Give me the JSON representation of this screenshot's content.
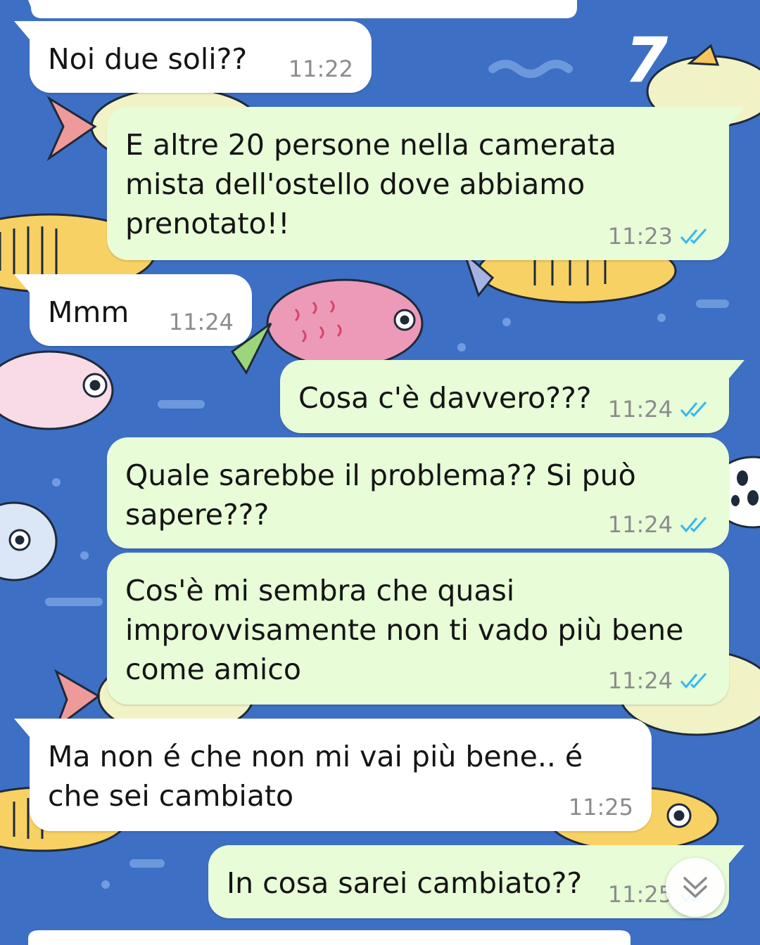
{
  "conversation": {
    "messages": [
      {
        "id": "m1",
        "direction": "incoming",
        "text": "Noi due soli??",
        "time": "11:22"
      },
      {
        "id": "m2",
        "direction": "outgoing",
        "text": "E altre 20 persone nella camerata\nmista dell'ostello dove abbiamo\nprenotato!!",
        "time": "11:23",
        "status": "read"
      },
      {
        "id": "m3",
        "direction": "incoming",
        "text": "Mmm",
        "time": "11:24"
      },
      {
        "id": "m4",
        "direction": "outgoing",
        "text": "Cosa c'è davvero???",
        "time": "11:24",
        "status": "read"
      },
      {
        "id": "m5",
        "direction": "outgoing",
        "text": "Quale sarebbe il problema?? Si può\nsapere???",
        "time": "11:24",
        "status": "read"
      },
      {
        "id": "m6",
        "direction": "outgoing",
        "text": "Cos'è mi sembra che quasi\nimprovvisamente non ti vado più bene\ncome amico",
        "time": "11:24",
        "status": "read"
      },
      {
        "id": "m7",
        "direction": "incoming",
        "text": "Ma non é che non mi vai più bene.. é\nche sei cambiato",
        "time": "11:25"
      },
      {
        "id": "m8",
        "direction": "outgoing",
        "text": "In cosa sarei cambiato??",
        "time": "11:25",
        "status": "read"
      }
    ]
  },
  "annotation": {
    "text": "7"
  },
  "icons": {
    "read_receipt": "double-check-icon",
    "scroll_to_bottom": "double-chevron-down-icon"
  },
  "colors": {
    "wallpaper": "#3d6fc4",
    "incoming_bubble": "#ffffff",
    "outgoing_bubble": "#e7fcd7",
    "read_ticks": "#34b7f1",
    "timestamp": "#8c8c8c"
  }
}
